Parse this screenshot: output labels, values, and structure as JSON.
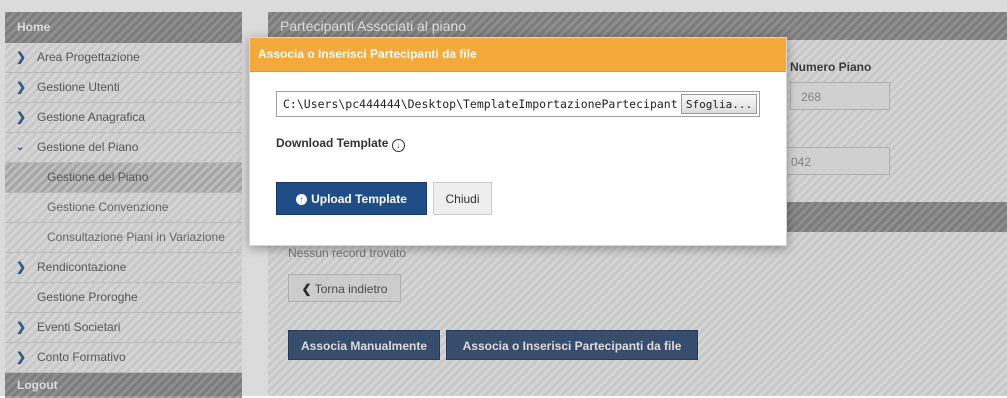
{
  "sidebar": {
    "home": "Home",
    "items": [
      {
        "label": "Area Progettazione",
        "chevron": ">"
      },
      {
        "label": "Gestione Utenti",
        "chevron": ">"
      },
      {
        "label": "Gestione Anagrafica",
        "chevron": ">"
      },
      {
        "label": "Gestione del Piano",
        "chevron": "v"
      }
    ],
    "sub_items": [
      {
        "label": "Gestione del Piano",
        "active": true
      },
      {
        "label": "Gestione Convenzione"
      },
      {
        "label": "Consultazione Piani in Variazione"
      }
    ],
    "items2": [
      {
        "label": "Rendicontazione",
        "chevron": ">"
      },
      {
        "label": "Gestione Proroghe",
        "chevron": ""
      },
      {
        "label": "Eventi Societari",
        "chevron": ">"
      },
      {
        "label": "Conto Formativo",
        "chevron": ">"
      }
    ],
    "logout": "Logout"
  },
  "main": {
    "title": "Partecipanti Associati al piano",
    "numero_piano_label": "Numero Piano",
    "numero_piano_value": "268",
    "second_value": "042",
    "no_record": "Nessun record trovato",
    "back_label": "Torna indietro",
    "associa_manualmente": "Associa Manualmente",
    "associa_file": "Associa o Inserisci Partecipanti da file"
  },
  "modal": {
    "title": "Associa o Inserisci Partecipanti da file",
    "file_path": "C:\\Users\\pc444444\\Desktop\\TemplateImportazionePartecipant",
    "browse_label": "Sfoglia...",
    "download_label": "Download Template",
    "upload_label": "Upload Template",
    "close_label": "Chiudi"
  },
  "colors": {
    "modal_header": "#f4a93a",
    "upload_button": "#1f4e86",
    "action_button": "#3f5a7e"
  }
}
